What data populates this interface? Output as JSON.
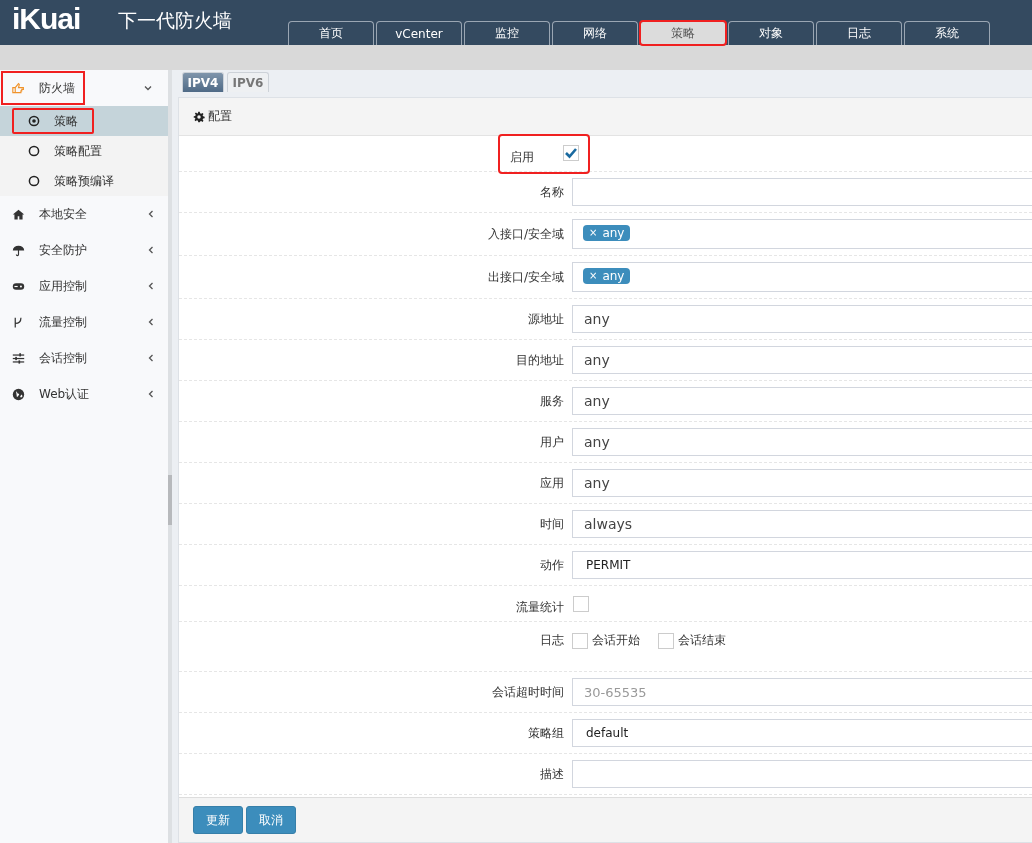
{
  "header": {
    "logo": "iKuai",
    "title": "下一代防火墙"
  },
  "nav_tabs": [
    {
      "label": "首页",
      "selected": false,
      "highlighted": false
    },
    {
      "label": "vCenter",
      "selected": false,
      "highlighted": false
    },
    {
      "label": "监控",
      "selected": false,
      "highlighted": false
    },
    {
      "label": "网络",
      "selected": false,
      "highlighted": false
    },
    {
      "label": "策略",
      "selected": true,
      "highlighted": true
    },
    {
      "label": "对象",
      "selected": false,
      "highlighted": false
    },
    {
      "label": "日志",
      "selected": false,
      "highlighted": false
    },
    {
      "label": "系统",
      "selected": false,
      "highlighted": false
    }
  ],
  "sidebar": {
    "items": [
      {
        "label": "防火墙",
        "kind": "hand",
        "expanded": true,
        "highlighted": true,
        "children": [
          {
            "label": "策略",
            "selected": true,
            "highlighted": true
          },
          {
            "label": "策略配置",
            "selected": false,
            "highlighted": false
          },
          {
            "label": "策略预编译",
            "selected": false,
            "highlighted": false
          }
        ]
      },
      {
        "label": "本地安全",
        "kind": "home",
        "expanded": false,
        "highlighted": false
      },
      {
        "label": "安全防护",
        "kind": "umbrella",
        "expanded": false,
        "highlighted": false
      },
      {
        "label": "应用控制",
        "kind": "gamepad",
        "expanded": false,
        "highlighted": false
      },
      {
        "label": "流量控制",
        "kind": "branch",
        "expanded": false,
        "highlighted": false
      },
      {
        "label": "会话控制",
        "kind": "sliders",
        "expanded": false,
        "highlighted": false
      },
      {
        "label": "Web认证",
        "kind": "globe",
        "expanded": false,
        "highlighted": false
      }
    ]
  },
  "sub_tabs": [
    {
      "label": "IPV4",
      "selected": true
    },
    {
      "label": "IPV6",
      "selected": false
    }
  ],
  "panel": {
    "title": "配置",
    "fields": [
      {
        "kind": "checkbox",
        "label": "启用",
        "checked": true,
        "highlighted": true
      },
      {
        "kind": "text",
        "label": "名称"
      },
      {
        "kind": "tags",
        "label": "入接口/安全域",
        "tags": [
          {
            "remove": "×",
            "label": "any"
          }
        ]
      },
      {
        "kind": "tags",
        "label": "出接口/安全域",
        "tags": [
          {
            "remove": "×",
            "label": "any"
          }
        ]
      },
      {
        "kind": "text",
        "label": "源地址",
        "value": "any"
      },
      {
        "kind": "text",
        "label": "目的地址",
        "value": "any"
      },
      {
        "kind": "text",
        "label": "服务",
        "value": "any"
      },
      {
        "kind": "text",
        "label": "用户",
        "value": "any"
      },
      {
        "kind": "text",
        "label": "应用",
        "value": "any"
      },
      {
        "kind": "text",
        "label": "时间",
        "value": "always"
      },
      {
        "kind": "select",
        "label": "动作",
        "value": "PERMIT"
      },
      {
        "kind": "checkbox",
        "label": "流量统计",
        "checked": false,
        "highlighted": false
      },
      {
        "kind": "checkbox-group",
        "label": "日志",
        "options": [
          {
            "label": "会话开始",
            "checked": false
          },
          {
            "label": "会话结束",
            "checked": false
          }
        ]
      },
      {
        "kind": "text",
        "label": "会话超时时间",
        "placeholder": "30-65535"
      },
      {
        "kind": "select",
        "label": "策略组",
        "value": "default"
      },
      {
        "kind": "text",
        "label": "描述"
      }
    ],
    "buttons": [
      {
        "label": "更新"
      },
      {
        "label": "取消"
      }
    ]
  }
}
